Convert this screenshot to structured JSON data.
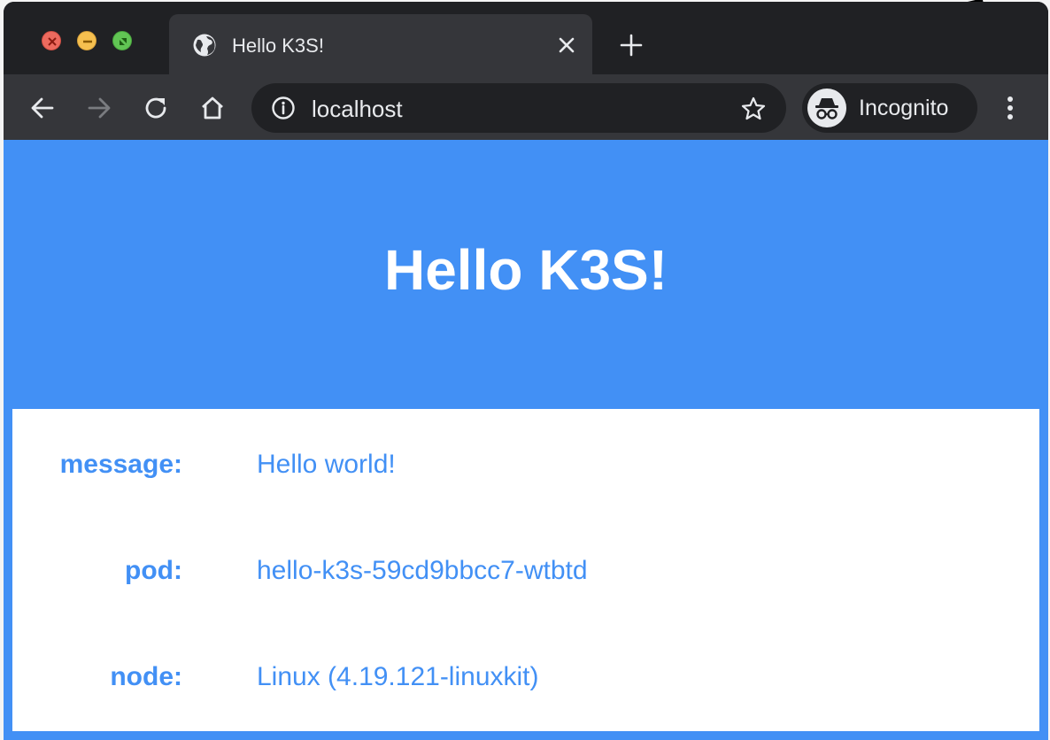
{
  "browser": {
    "tab": {
      "title": "Hello K3S!",
      "icon": "globe-icon"
    },
    "address_bar": {
      "url": "localhost",
      "icon": "info-icon"
    },
    "profile": {
      "label": "Incognito",
      "icon": "incognito-icon"
    },
    "colors": {
      "frame": "#202124",
      "toolbar": "#35363a"
    }
  },
  "page": {
    "heading": "Hello K3S!",
    "fields": [
      {
        "label": "message:",
        "value": "Hello world!"
      },
      {
        "label": "pod:",
        "value": "hello-k3s-59cd9bbcc7-wtbtd"
      },
      {
        "label": "node:",
        "value": "Linux (4.19.121-linuxkit)"
      }
    ],
    "colors": {
      "accent": "#4290f5",
      "card": "#ffffff"
    }
  }
}
